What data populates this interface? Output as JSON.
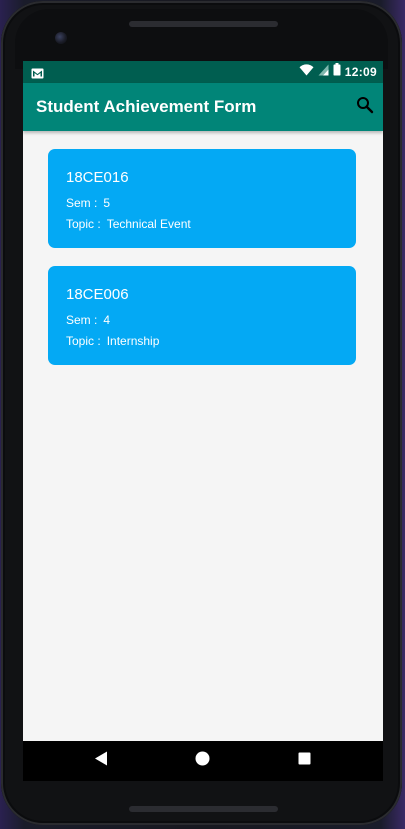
{
  "status_bar": {
    "time": "12:09",
    "left_icon": "gmail-icon",
    "right_icons": [
      "wifi-icon",
      "signal-icon",
      "battery-icon"
    ]
  },
  "app_bar": {
    "title": "Student Achievement Form",
    "action_icon": "search-icon",
    "color": "#018578"
  },
  "cards": [
    {
      "id": "18CE016",
      "sem_label": "Sem :",
      "sem_value": "5",
      "topic_label": "Topic :",
      "topic_value": "Technical Event"
    },
    {
      "id": "18CE006",
      "sem_label": "Sem :",
      "sem_value": "4",
      "topic_label": "Topic :",
      "topic_value": "Internship"
    }
  ],
  "colors": {
    "status_bar": "#005e50",
    "card": "#04a9f4",
    "background": "#f5f5f5"
  },
  "nav_bar": {
    "buttons": [
      "back-icon",
      "home-icon",
      "recents-icon"
    ]
  }
}
